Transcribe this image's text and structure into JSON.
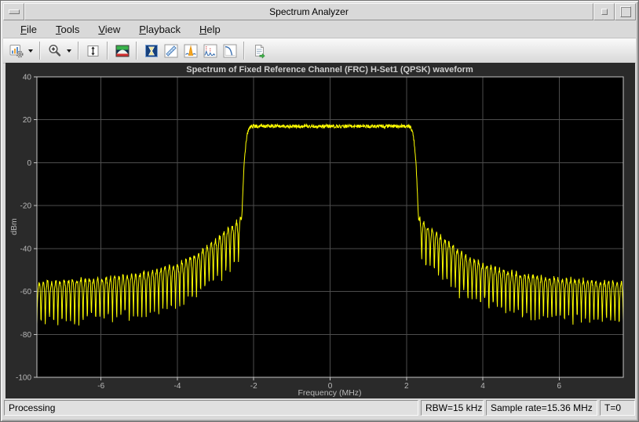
{
  "window": {
    "title": "Spectrum Analyzer"
  },
  "menubar": {
    "items": [
      {
        "label": "File"
      },
      {
        "label": "Tools"
      },
      {
        "label": "View"
      },
      {
        "label": "Playback"
      },
      {
        "label": "Help"
      }
    ]
  },
  "toolbar": {
    "buttons": [
      {
        "name": "configuration-properties",
        "icon": "chart-gear-icon",
        "dropdown": true
      },
      {
        "name": "zoom",
        "icon": "zoom-in-icon",
        "dropdown": true
      },
      {
        "name": "scale-axes",
        "icon": "axes-span-icon",
        "dropdown": false
      },
      {
        "name": "spectrum-settings",
        "icon": "spectrum-icon",
        "dropdown": false
      },
      {
        "name": "spectral-mask",
        "icon": "mask-icon",
        "dropdown": false
      },
      {
        "name": "cursor-measurements",
        "icon": "ruler-icon",
        "dropdown": false
      },
      {
        "name": "peak-finder",
        "icon": "peak-icon",
        "dropdown": false
      },
      {
        "name": "distortion-measurements",
        "icon": "distortion-icon",
        "dropdown": false
      },
      {
        "name": "ccdf-measurements",
        "icon": "ccdf-icon",
        "dropdown": false
      },
      {
        "name": "generate-script",
        "icon": "document-export-icon",
        "dropdown": false
      }
    ]
  },
  "statusbar": {
    "status": "Processing",
    "rbw": "RBW=15 kHz",
    "sample_rate": "Sample rate=15.36 MHz",
    "time": "T=0"
  },
  "chart_data": {
    "type": "line",
    "title": "Spectrum of Fixed Reference Channel (FRC) H-Set1 (QPSK) waveform",
    "xlabel": "Frequency (MHz)",
    "ylabel": "dBm",
    "xlim": [
      -7.68,
      7.68
    ],
    "ylim": [
      -100,
      40
    ],
    "xticks": [
      -6,
      -4,
      -2,
      0,
      2,
      4,
      6
    ],
    "xtick_labels": [
      "-6",
      "-4",
      "-2",
      "0",
      "2",
      "4",
      "6"
    ],
    "yticks": [
      40,
      20,
      0,
      -20,
      -40,
      -60,
      -80,
      -100
    ],
    "ytick_labels": [
      "40",
      "20",
      "0",
      "-20",
      "-40",
      "-60",
      "-80",
      "-100"
    ],
    "grid": true,
    "legend": "none",
    "background": "#2a2a2a",
    "axes_background": "#000000",
    "grid_color": "#4d4d4d",
    "series": [
      {
        "name": "FRC H-Set1 (QPSK) spectrum",
        "color": "#ffff00"
      }
    ],
    "spectrum": {
      "passband_level_dbm": 17,
      "passband_edge_mhz": 2.0,
      "transition_width_mhz": 0.38,
      "rolloff_exponent": 4,
      "rolloff_depth_db": 95,
      "noise_ripple_db": 1.7,
      "sidelobe_period_mhz": 0.11,
      "sidelobe_phase_mhz": 2.4,
      "sidelobe_null_depth_db": 16,
      "sidelobe_envelope": [
        [
          2.35,
          -26
        ],
        [
          2.6,
          -30
        ],
        [
          3.0,
          -36
        ],
        [
          3.5,
          -43
        ],
        [
          4.0,
          -47.5
        ],
        [
          4.5,
          -50
        ],
        [
          5.0,
          -52
        ],
        [
          5.5,
          -53
        ],
        [
          6.0,
          -54
        ],
        [
          7.0,
          -55
        ],
        [
          7.68,
          -56
        ]
      ]
    }
  }
}
